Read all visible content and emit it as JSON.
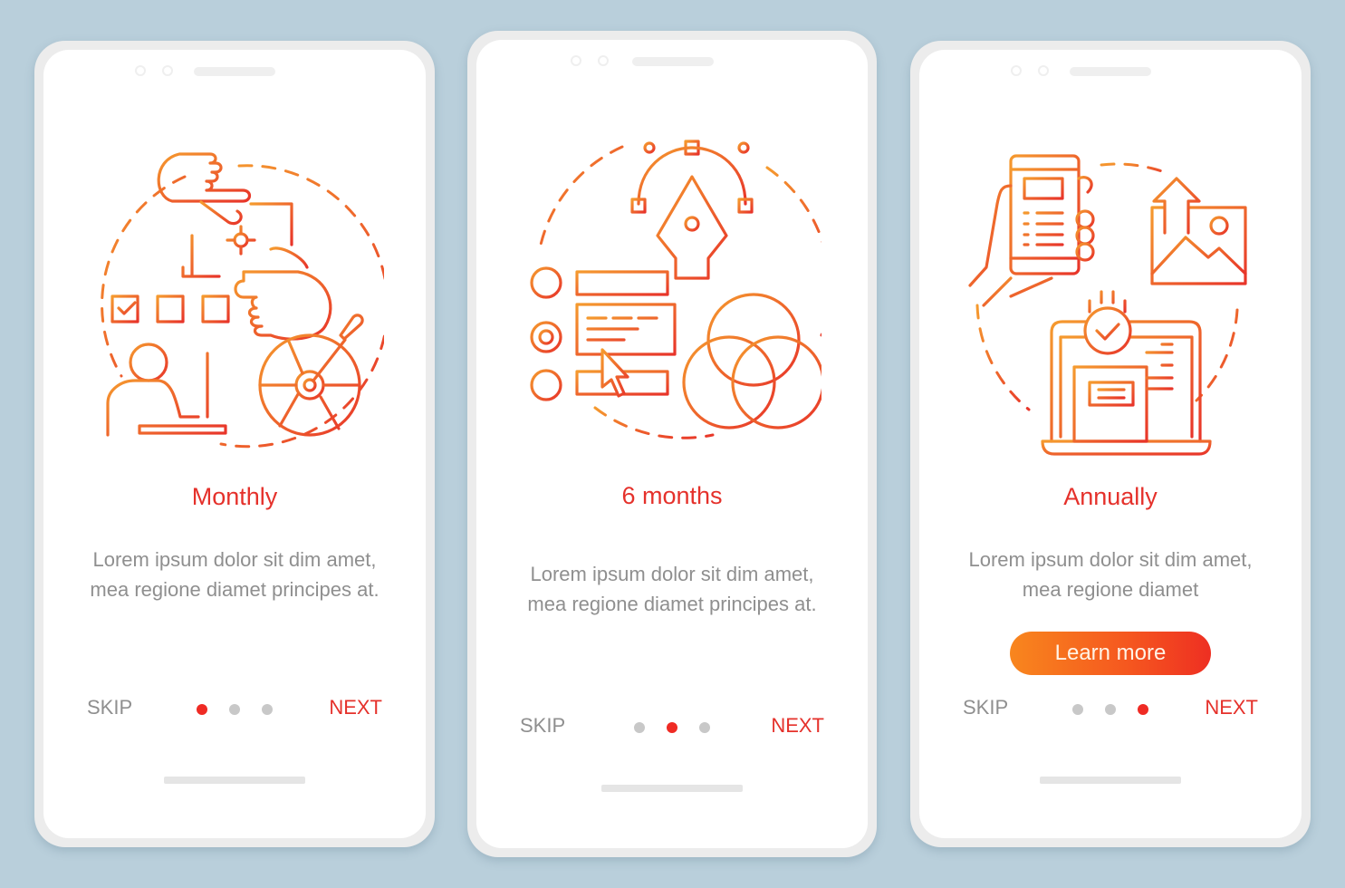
{
  "colors": {
    "background": "#b9cfdb",
    "accent_red": "#e5312b",
    "accent_orange": "#f8861e",
    "text_gray": "#8f8f8f",
    "dot_inactive": "#c8c8c8",
    "dot_active": "#ef2b24"
  },
  "screens": [
    {
      "illustration": "design-work-illustration",
      "title": "Monthly",
      "description": "Lorem ipsum dolor sit dim amet, mea regione diamet principes at.",
      "skip_label": "SKIP",
      "next_label": "NEXT",
      "page_indicator": {
        "current": 1,
        "total": 3
      }
    },
    {
      "illustration": "graphic-design-tools-illustration",
      "title": "6 months",
      "description": "Lorem ipsum dolor sit dim amet, mea regione diamet principes at.",
      "skip_label": "SKIP",
      "next_label": "NEXT",
      "page_indicator": {
        "current": 2,
        "total": 3
      }
    },
    {
      "illustration": "publishing-devices-illustration",
      "title": "Annually",
      "description": "Lorem ipsum dolor sit dim amet, mea regione diamet",
      "button_label": "Learn more",
      "skip_label": "SKIP",
      "next_label": "NEXT",
      "page_indicator": {
        "current": 3,
        "total": 3
      }
    }
  ]
}
